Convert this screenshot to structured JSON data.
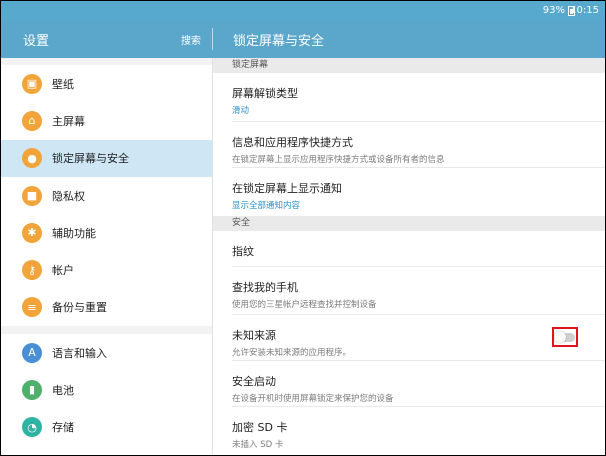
{
  "status_bar": {
    "battery_percent": "93%",
    "time": "10:15"
  },
  "app_bar": {
    "title": "设置",
    "search_label": "搜索",
    "section_title": "锁定屏幕与安全"
  },
  "sidebar": {
    "items": [
      {
        "label": "壁纸",
        "icon": "image-icon"
      },
      {
        "label": "主屏幕",
        "icon": "home-icon"
      },
      {
        "label": "锁定屏幕与安全",
        "icon": "lock-icon",
        "selected": true
      },
      {
        "label": "隐私权",
        "icon": "privacy-icon"
      },
      {
        "label": "辅助功能",
        "icon": "accessibility-icon"
      },
      {
        "label": "帐户",
        "icon": "key-icon"
      },
      {
        "label": "备份与重置",
        "icon": "backup-icon"
      },
      {
        "label": "语言和输入",
        "icon": "language-icon"
      },
      {
        "label": "电池",
        "icon": "battery-icon"
      },
      {
        "label": "存储",
        "icon": "storage-icon"
      }
    ]
  },
  "content": {
    "lockscreen_header": "锁定屏幕",
    "security_header": "安全",
    "rows": [
      {
        "title": "屏幕解锁类型",
        "sub": "滑动"
      },
      {
        "title": "信息和应用程序快捷方式",
        "sub": "在锁定屏幕上显示应用程序快捷方式或设备所有者的信息"
      },
      {
        "title": "在锁定屏幕上显示通知",
        "sub": "显示全部通知内容"
      },
      {
        "title": "指纹"
      },
      {
        "title": "查找我的手机",
        "sub": "使用您的三星帐户远程查找并控制设备"
      },
      {
        "title": "未知来源",
        "sub": "允许安装未知来源的应用程序。",
        "toggle_on": false
      },
      {
        "title": "安全启动",
        "sub": "在设备开机时使用屏幕锁定来保护您的设备"
      },
      {
        "title": "加密 SD 卡",
        "sub": "未插入 SD 卡"
      }
    ]
  },
  "colors": {
    "accent": "#5aa7cb",
    "selected": "#cfe7f5",
    "highlight_box": "#e0141e"
  }
}
